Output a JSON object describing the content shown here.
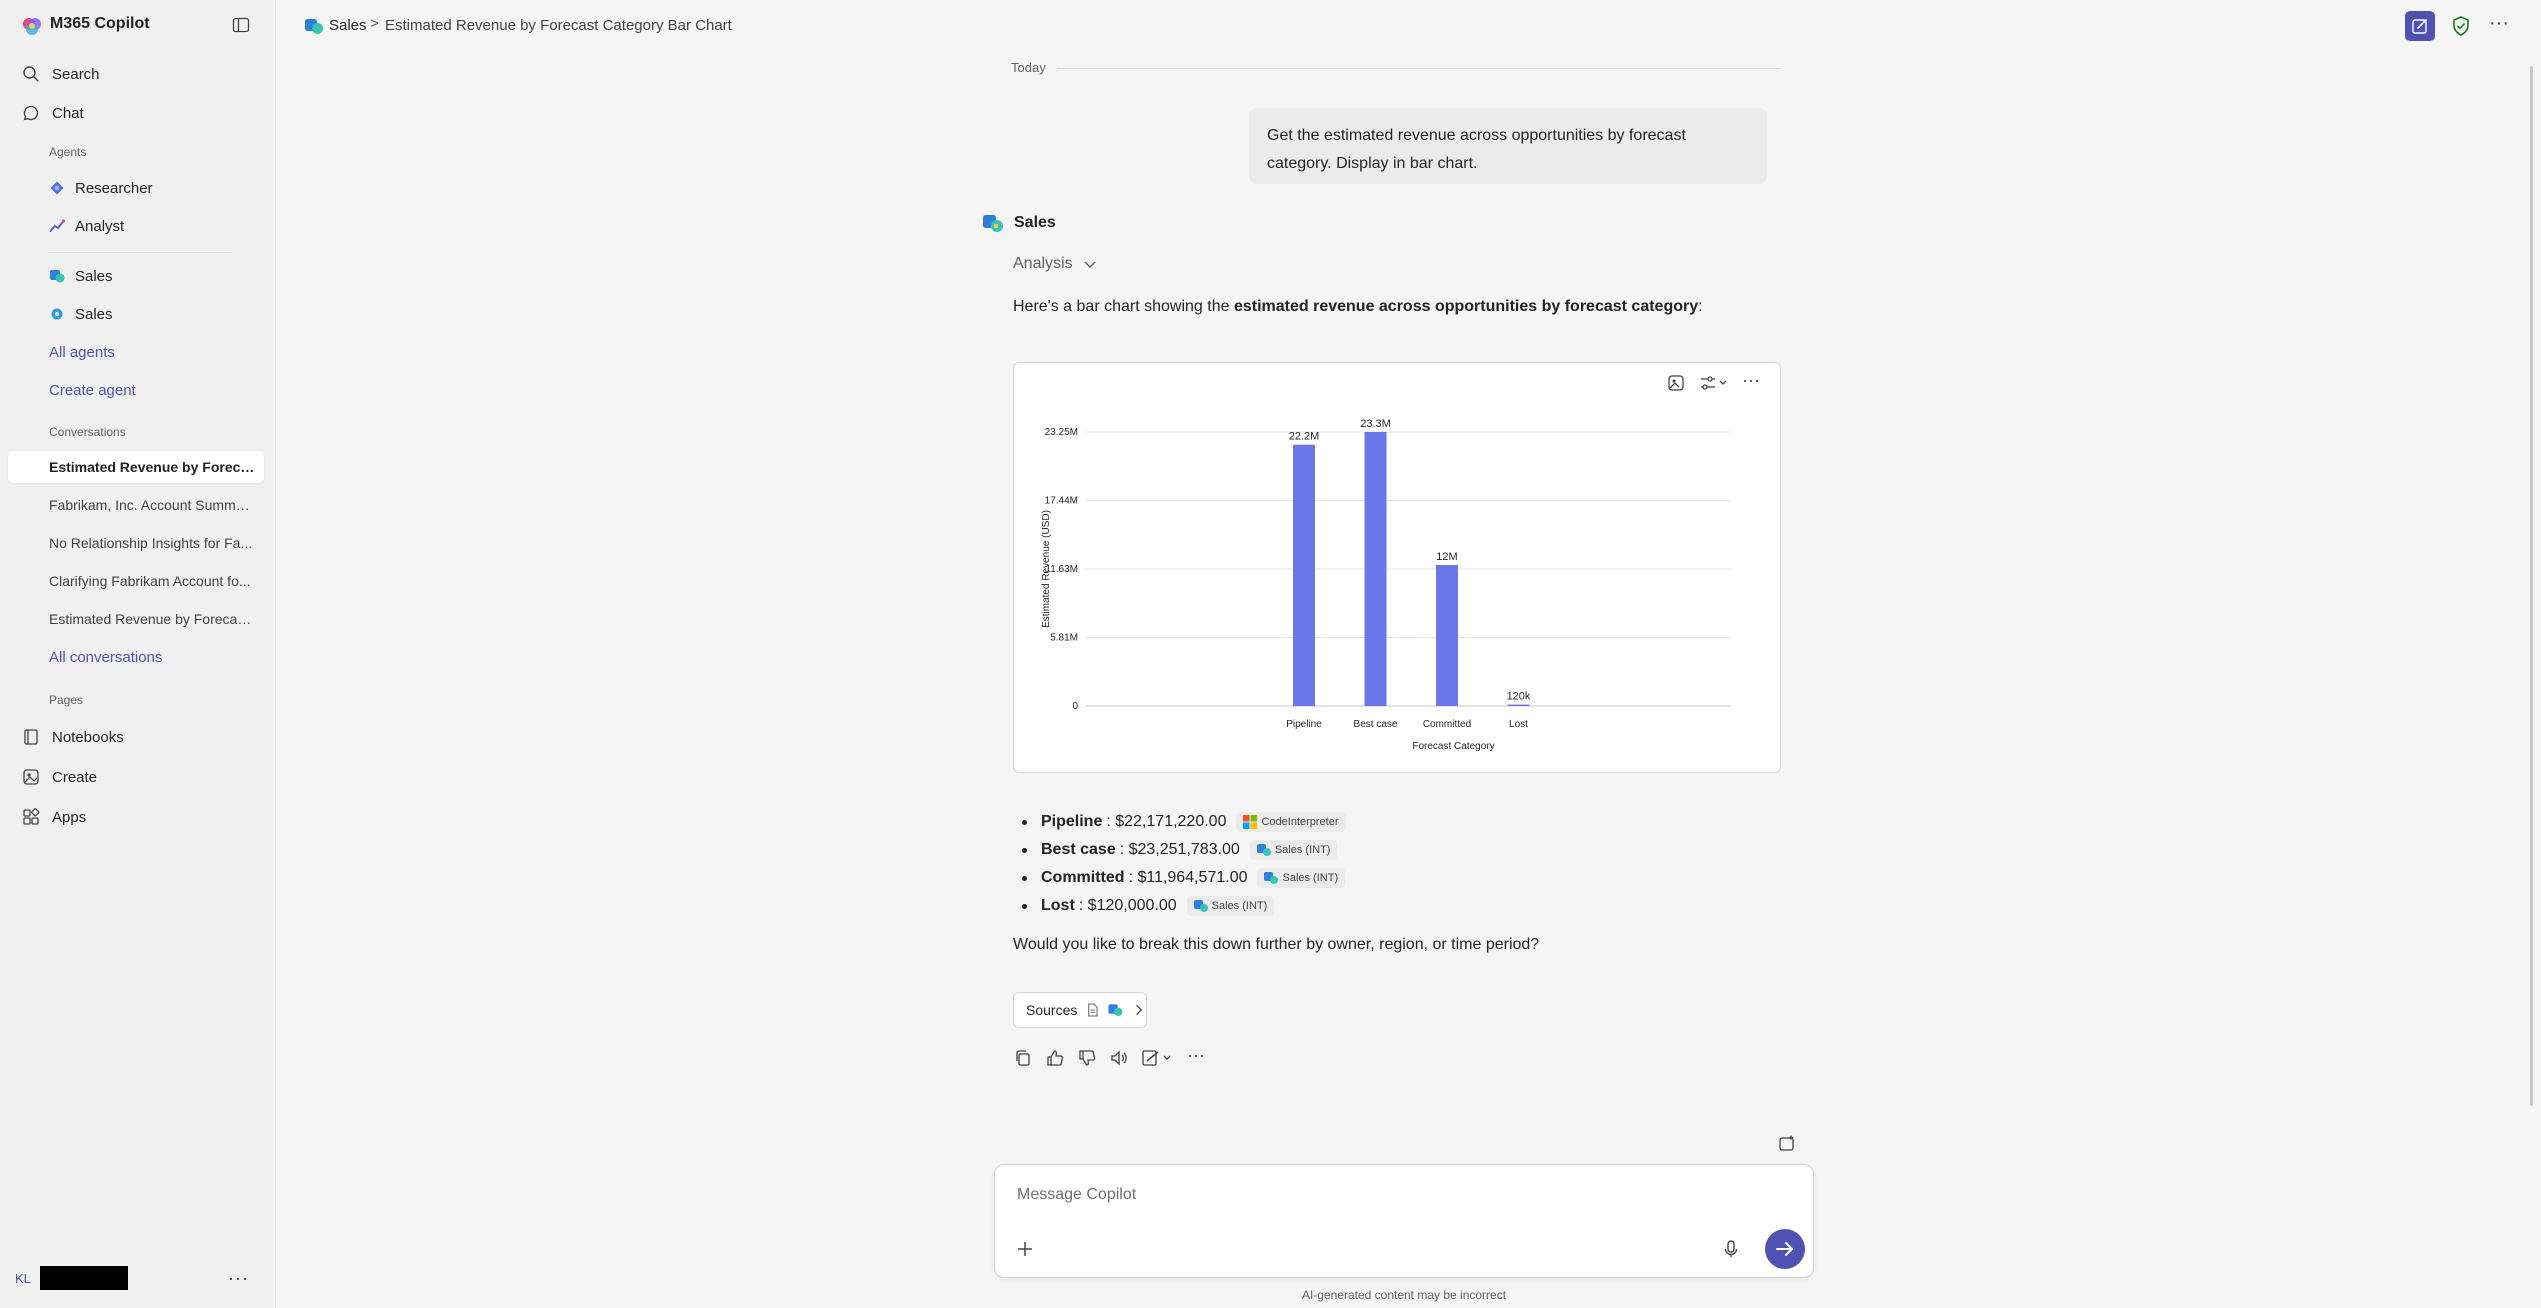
{
  "app": {
    "title": "M365 Copilot"
  },
  "sidebar": {
    "nav": [
      {
        "label": "Search",
        "icon": "search-icon"
      },
      {
        "label": "Chat",
        "icon": "chat-icon"
      }
    ],
    "agents_label": "Agents",
    "agents": [
      {
        "label": "Researcher",
        "icon": "researcher-icon"
      },
      {
        "label": "Analyst",
        "icon": "analyst-icon"
      },
      {
        "label": "Sales",
        "icon": "sales-icon"
      },
      {
        "label": "Sales",
        "icon": "sales-icon"
      }
    ],
    "all_agents": "All agents",
    "create_agent": "Create agent",
    "conversations_label": "Conversations",
    "conversations": [
      {
        "label": "Estimated Revenue by Foreca...",
        "active": true
      },
      {
        "label": "Fabrikam, Inc. Account Summa...",
        "active": false
      },
      {
        "label": "No Relationship Insights for Fa...",
        "active": false
      },
      {
        "label": "Clarifying Fabrikam Account fo...",
        "active": false
      },
      {
        "label": "Estimated Revenue by Forecas...",
        "active": false
      }
    ],
    "all_conversations": "All conversations",
    "pages_label": "Pages",
    "pages": [
      {
        "label": "Notebooks",
        "icon": "notebook-icon"
      },
      {
        "label": "Create",
        "icon": "create-icon"
      },
      {
        "label": "Apps",
        "icon": "apps-icon"
      }
    ],
    "user_initials": "KL"
  },
  "header": {
    "breadcrumb_root": "Sales",
    "breadcrumb_sep": ">",
    "title": "Estimated Revenue by Forecast Category Bar Chart"
  },
  "chat": {
    "date_label": "Today",
    "user_message": "Get the estimated revenue across opportunities by forecast category. Display in bar chart.",
    "agent_name": "Sales",
    "analysis_label": "Analysis",
    "intro_prefix": "Here's a bar chart showing the ",
    "intro_bold": "estimated revenue across opportunities by forecast category",
    "intro_suffix": ":",
    "bullets": [
      {
        "label": "Pipeline",
        "value": ": $22,171,220.00",
        "cite": "CodeInterpreter",
        "cite_icon": "code-interpreter-icon"
      },
      {
        "label": "Best case",
        "value": ": $23,251,783.00",
        "cite": "Sales (INT)",
        "cite_icon": "sales-icon"
      },
      {
        "label": "Committed",
        "value": ": $11,964,571.00",
        "cite": "Sales (INT)",
        "cite_icon": "sales-icon"
      },
      {
        "label": "Lost",
        "value": ": $120,000.00",
        "cite": "Sales (INT)",
        "cite_icon": "sales-icon"
      }
    ],
    "followup": "Would you like to break this down further by owner, region, or time period?",
    "sources_label": "Sources"
  },
  "composer": {
    "placeholder": "Message Copilot",
    "disclaimer": "AI-generated content may be incorrect"
  },
  "chart_data": {
    "type": "bar",
    "categories": [
      "Pipeline",
      "Best case",
      "Committed",
      "Lost"
    ],
    "values": [
      22171220,
      23251783,
      11964571,
      120000
    ],
    "data_labels": [
      "22.2M",
      "23.3M",
      "12M",
      "120k"
    ],
    "yticks": [
      0,
      5810000,
      11630000,
      17440000,
      23250000
    ],
    "ytick_labels": [
      "0",
      "5.81M",
      "11.63M",
      "17.44M",
      "23.25M"
    ],
    "ylim": [
      0,
      23250000
    ],
    "xlabel": "Forecast Category",
    "ylabel": "Estimated Revenue (USD)",
    "grid": true,
    "bar_color": "#6b77e8"
  },
  "colors": {
    "accent": "#4f52b2",
    "bar": "#6b77e8"
  }
}
